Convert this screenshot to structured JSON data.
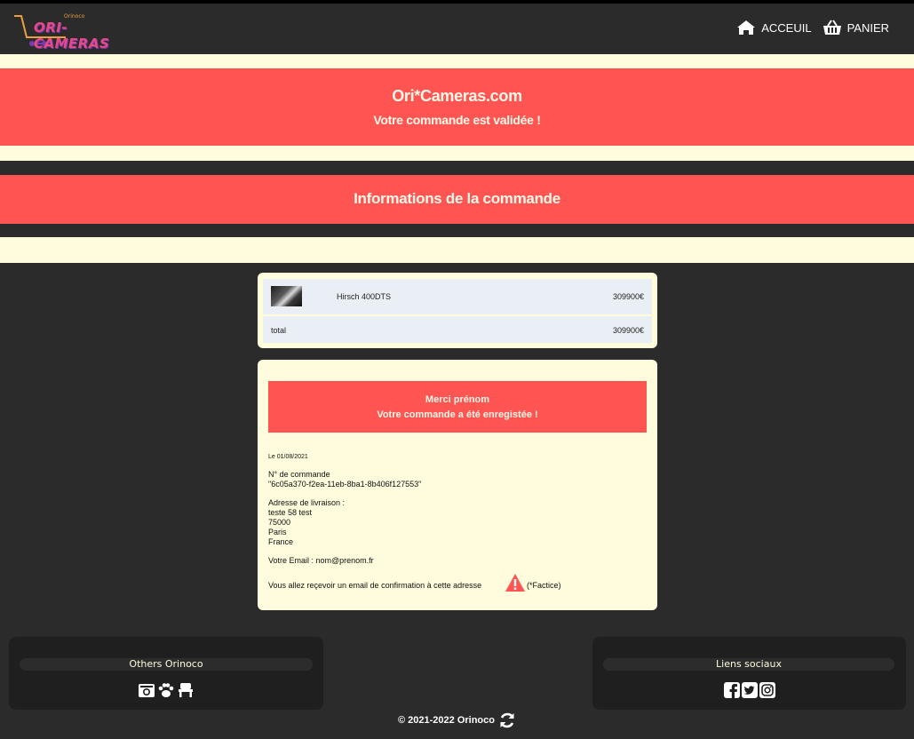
{
  "colors": {
    "background": "#2b2b2b",
    "accent_red": "#ff5552",
    "cream": "#fefcdc",
    "row_bg": "#e9eff4",
    "footer_box": "#1f1f1f"
  },
  "header": {
    "logo_text": "ORI-CAMERAS",
    "logo_small": "Orinoco",
    "nav": [
      {
        "label": "ACCEUIL",
        "icon": "home-icon"
      },
      {
        "label": "PANIER",
        "icon": "basket-icon"
      }
    ]
  },
  "banner": {
    "title": "Ori*Cameras.com",
    "subtitle": "Votre commande est validée !"
  },
  "section": {
    "title": "Informations de la commande"
  },
  "cart": {
    "items": [
      {
        "name": "Hirsch 400DTS",
        "price": "309900€"
      }
    ],
    "total_label": "total",
    "total_price": "309900€"
  },
  "order": {
    "thanks_line1": "Merci prénom",
    "thanks_line2": "Votre commande a été enregistée !",
    "date": "Le 01/08/2021",
    "number_label": "N° de commande",
    "number_value": "\"6c05a370-f2ea-11eb-8ba1-8b406f127553\"",
    "address_label": "Adresse de livraison :",
    "address_lines": [
      "teste 58 test",
      "75000",
      "Paris",
      "France"
    ],
    "email_line": "Votre Email : nom@prenom.fr",
    "confirm_text": "Vous allez reçevoir un email de confirmation à cette adresse",
    "factice": "(*Factice)"
  },
  "footer": {
    "others_title": "Others Orinoco",
    "others_icons": [
      "camera-icon",
      "paw-icon",
      "chair-icon"
    ],
    "social_title": "Liens sociaux",
    "social_icons": [
      "facebook-icon",
      "twitter-icon",
      "instagram-icon"
    ],
    "copyright": "© 2021-2022 Orinoco"
  }
}
